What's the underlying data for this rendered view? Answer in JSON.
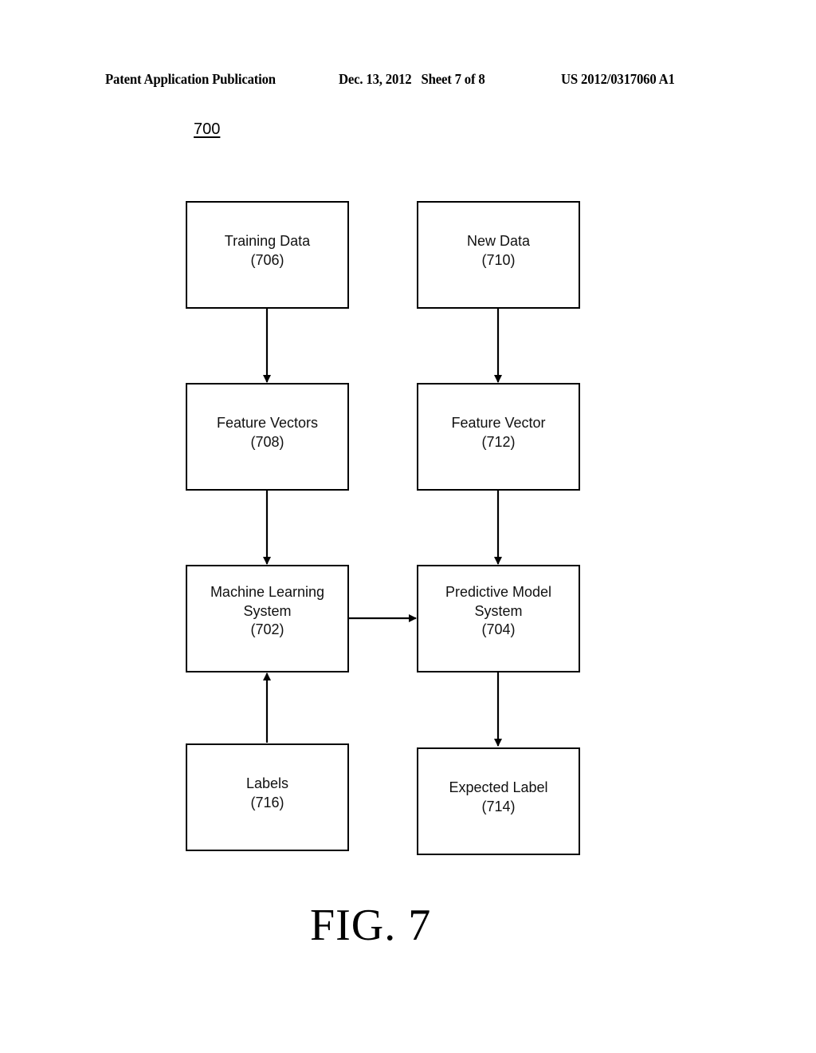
{
  "header": {
    "publication": "Patent Application Publication",
    "date_sheet": "Dec. 13, 2012   Sheet 7 of 8",
    "patent_number": "US 2012/0317060 A1"
  },
  "figure_ref": "700",
  "figure_label": "FIG. 7",
  "boxes": {
    "training_data": {
      "line1": "Training Data",
      "ref": "(706)"
    },
    "new_data": {
      "line1": "New Data",
      "ref": "(710)"
    },
    "feature_vectors": {
      "line1": "Feature Vectors",
      "ref": "(708)"
    },
    "feature_vector": {
      "line1": "Feature Vector",
      "ref": "(712)"
    },
    "ml_system": {
      "line1": "Machine Learning",
      "line2": "System",
      "ref": "(702)"
    },
    "predictive_model": {
      "line1": "Predictive Model",
      "line2": "System",
      "ref": "(704)"
    },
    "labels": {
      "line1": "Labels",
      "ref": "(716)"
    },
    "expected_label": {
      "line1": "Expected Label",
      "ref": "(714)"
    }
  },
  "edges": [
    {
      "from": "training_data",
      "to": "feature_vectors"
    },
    {
      "from": "feature_vectors",
      "to": "ml_system"
    },
    {
      "from": "new_data",
      "to": "feature_vector"
    },
    {
      "from": "feature_vector",
      "to": "predictive_model"
    },
    {
      "from": "ml_system",
      "to": "predictive_model"
    },
    {
      "from": "labels",
      "to": "ml_system"
    },
    {
      "from": "predictive_model",
      "to": "expected_label"
    }
  ]
}
